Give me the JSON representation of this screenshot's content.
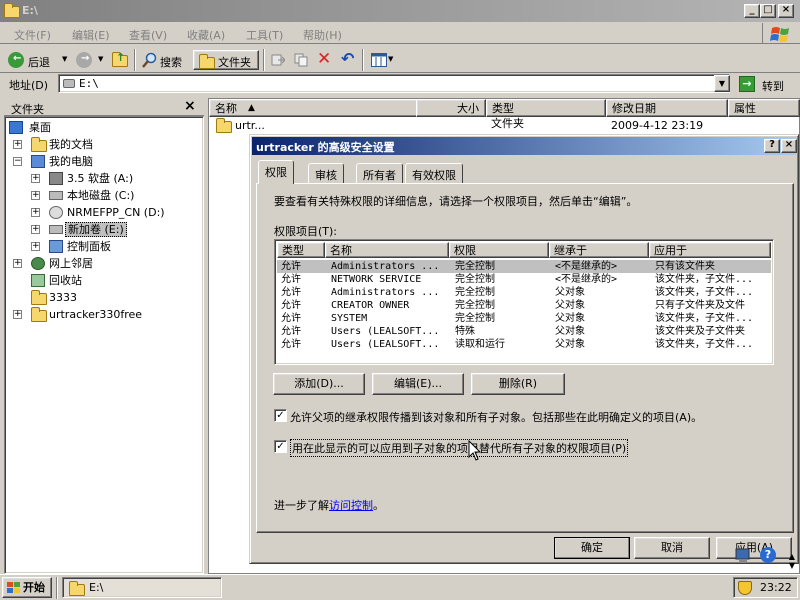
{
  "window": {
    "title": "E:\\"
  },
  "menu": [
    "文件(F)",
    "编辑(E)",
    "查看(V)",
    "收藏(A)",
    "工具(T)",
    "帮助(H)"
  ],
  "toolbar": {
    "back": "后退",
    "search": "搜索",
    "folders": "文件夹"
  },
  "address": {
    "label": "地址(D)",
    "value": "E:\\",
    "go": "转到"
  },
  "folder_pane": {
    "title": "文件夹",
    "close": "×",
    "tree": [
      {
        "label": "桌面"
      },
      {
        "label": "我的文档"
      },
      {
        "label": "我的电脑"
      },
      {
        "label": "3.5 软盘 (A:)"
      },
      {
        "label": "本地磁盘 (C:)"
      },
      {
        "label": "NRMEFPP_CN (D:)"
      },
      {
        "label": "新加卷 (E:)"
      },
      {
        "label": "控制面板"
      },
      {
        "label": "网上邻居"
      },
      {
        "label": "回收站"
      },
      {
        "label": "3333"
      },
      {
        "label": "urtracker330free"
      }
    ]
  },
  "file_list": {
    "columns": [
      "名称",
      "大小",
      "类型",
      "修改日期",
      "属性"
    ],
    "row": {
      "name": "urtr...",
      "type": "文件夹",
      "date": "2009-4-12 23:19"
    }
  },
  "dialog": {
    "title": "urtracker 的高级安全设置",
    "help": "?",
    "close": "×",
    "tabs": [
      "权限",
      "审核",
      "所有者",
      "有效权限"
    ],
    "intro": "要查看有关特殊权限的详细信息，请选择一个权限项目，然后单击“编辑”。",
    "list_label": "权限项目(T):",
    "perm_columns": [
      "类型",
      "名称",
      "权限",
      "继承于",
      "应用于"
    ],
    "perm_rows": [
      {
        "type": "允许",
        "name": "Administrators ...",
        "perm": "完全控制",
        "inherit": "<不是继承的>",
        "apply": "只有该文件夹"
      },
      {
        "type": "允许",
        "name": "NETWORK SERVICE",
        "perm": "完全控制",
        "inherit": "<不是继承的>",
        "apply": "该文件夹，子文件..."
      },
      {
        "type": "允许",
        "name": "Administrators ...",
        "perm": "完全控制",
        "inherit": "父对象",
        "apply": "该文件夹，子文件..."
      },
      {
        "type": "允许",
        "name": "CREATOR OWNER",
        "perm": "完全控制",
        "inherit": "父对象",
        "apply": "只有子文件夹及文件"
      },
      {
        "type": "允许",
        "name": "SYSTEM",
        "perm": "完全控制",
        "inherit": "父对象",
        "apply": "该文件夹，子文件..."
      },
      {
        "type": "允许",
        "name": "Users (LEALSOFT...",
        "perm": "特殊",
        "inherit": "父对象",
        "apply": "该文件夹及子文件夹"
      },
      {
        "type": "允许",
        "name": "Users (LEALSOFT...",
        "perm": "读取和运行",
        "inherit": "父对象",
        "apply": "该文件夹，子文件..."
      }
    ],
    "buttons": {
      "add": "添加(D)...",
      "edit": "编辑(E)...",
      "remove": "删除(R)"
    },
    "check1": "允许父项的继承权限传播到该对象和所有子对象。包括那些在此明确定义的项目(A)。",
    "check2": "用在此显示的可以应用到子对象的项目替代所有子对象的权限项目(P)",
    "learn_prefix": "进一步了解",
    "learn_link": "访问控制",
    "learn_suffix": "。",
    "ok": "确定",
    "cancel": "取消",
    "apply": "应用(A)"
  },
  "taskbar": {
    "start": "开始",
    "task": "E:\\",
    "time": "23:22"
  },
  "colors": {
    "dialog_title": "#0a246a",
    "link": "#0000ff",
    "selection": "#c0c0c0"
  }
}
